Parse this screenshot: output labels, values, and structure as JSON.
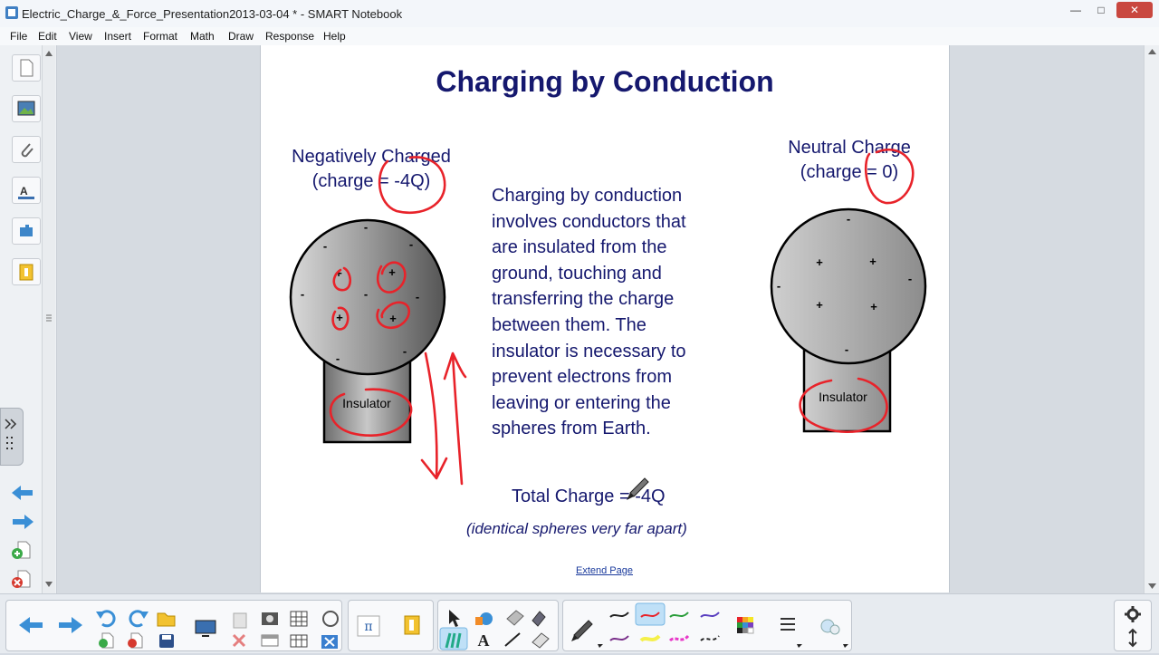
{
  "window": {
    "title": "Electric_Charge_&_Force_Presentation2013-03-04 * - SMART Notebook"
  },
  "menu": [
    "File",
    "Edit",
    "View",
    "Insert",
    "Format",
    "Math",
    "Draw",
    "Response",
    "Help"
  ],
  "slide": {
    "title": "Charging by Conduction",
    "left_label_line1": "Negatively Charged",
    "left_label_line2": "(charge = -4Q)",
    "right_label_line1": "Neutral Charge",
    "right_label_line2": "(charge = 0)",
    "insulator_left": "Insulator",
    "insulator_right": "Insulator",
    "body_lines": [
      "Charging by conduction",
      "involves conductors that",
      "are insulated from the",
      "ground, touching and",
      "transferring the charge",
      "between them. The",
      "insulator is necessary to",
      "prevent electrons from",
      "leaving or entering the",
      "spheres from Earth."
    ],
    "total_charge": "Total Charge = -4Q",
    "note": "(identical spheres very far apart)",
    "extend_page": "Extend Page",
    "minus_sign": "-",
    "plus_sign": "+"
  },
  "colors": {
    "ink": "#15186e",
    "annotation": "#e8232a",
    "selected_tool": "#bfe0f7"
  },
  "icons": {
    "sidebar": [
      "page-sorter-icon",
      "gallery-icon",
      "attachments-icon",
      "properties-icon",
      "addons-icon",
      "lesson-activity-icon"
    ],
    "sidebar_bottom": [
      "previous-page-icon",
      "next-page-icon",
      "add-page-icon",
      "delete-page-icon"
    ],
    "toolbar": [
      "back-icon",
      "forward-icon",
      "undo-icon",
      "redo-icon",
      "open-file-icon",
      "add-page-icon",
      "delete-page-icon",
      "save-icon",
      "screen-icon",
      "paste-icon",
      "delete-icon",
      "screen-shade-icon",
      "table-icon",
      "math-icon",
      "close-icon",
      "pi-icon",
      "activity-icon",
      "select-icon",
      "shapes-icon",
      "eraser-icon",
      "magic-pen-icon",
      "pens-icon",
      "text-icon",
      "line-icon",
      "creative-pen-icon",
      "pen-icon",
      "color-palette-icon",
      "line-style-icon",
      "fill-effects-icon",
      "settings-icon",
      "move-toolbar-icon"
    ]
  }
}
